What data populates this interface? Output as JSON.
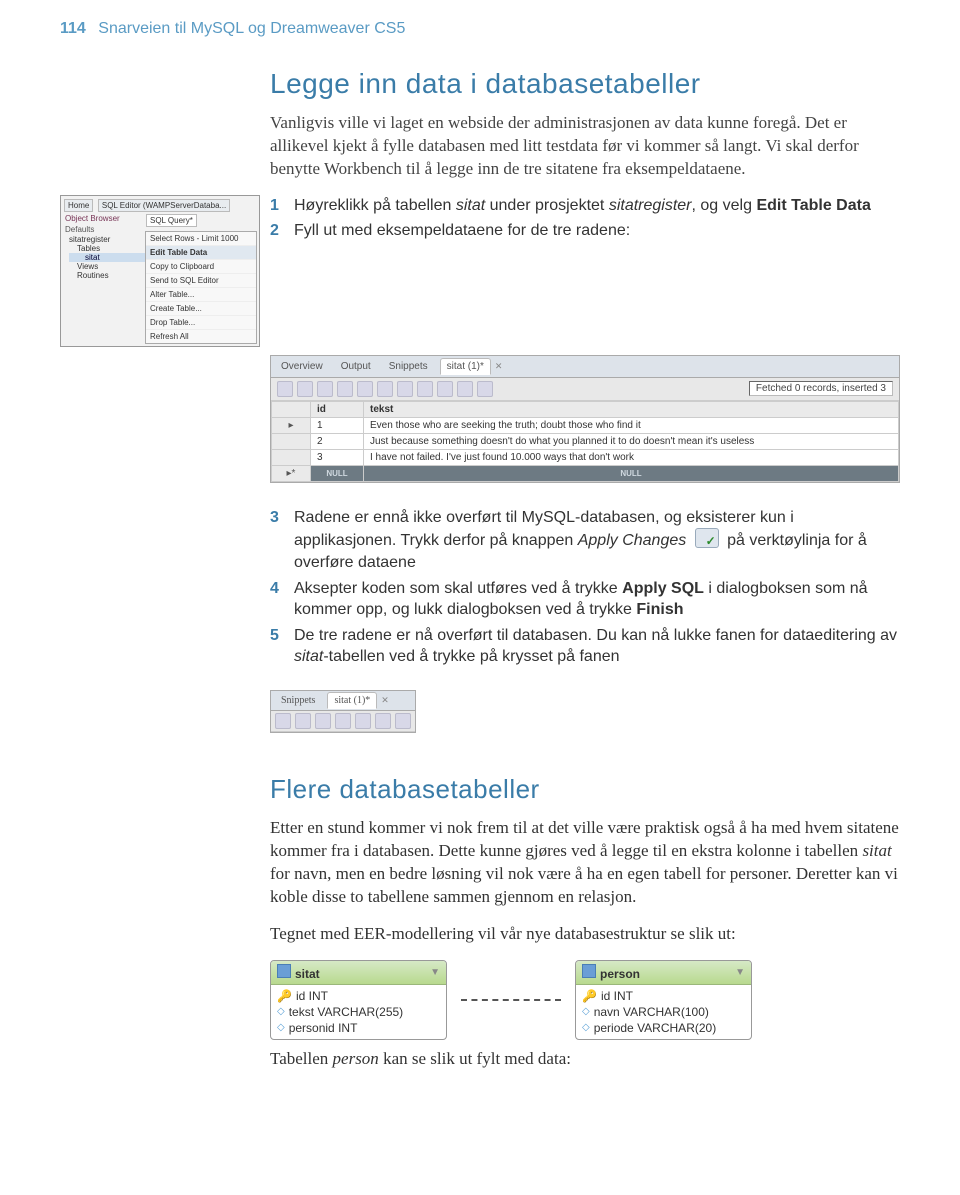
{
  "header": {
    "page_number": "114",
    "running_title": "Snarveien til MySQL og Dreamweaver CS5"
  },
  "section1": {
    "title": "Legge inn data i databasetabeller",
    "intro": "Vanligvis ville vi laget en webside der administrasjonen av data kunne foregå. Det er allikevel kjekt å fylle databasen med litt testdata før vi kommer så langt. Vi skal derfor benytte Workbench til å legge inn de tre sitatene fra eksempeldataene.",
    "workbench_left": {
      "home_tab": "Home",
      "server_tab": "SQL Editor (WAMPServerDataba...",
      "object_browser": "Object Browser",
      "sql_query_tab": "SQL Query*",
      "defaults": "Defaults",
      "tree": [
        "sitatregister",
        "Tables",
        "sitat",
        "Views",
        "Routines"
      ],
      "context_menu": [
        "Select Rows - Limit 1000",
        "Edit Table Data",
        "Copy to Clipboard",
        "Send to SQL Editor",
        "Alter Table...",
        "Create Table...",
        "Drop Table...",
        "Refresh All"
      ]
    },
    "step1": {
      "n": "1",
      "pre": "Høyreklikk på tabellen ",
      "em1": "sitat",
      "mid": " under prosjektet ",
      "em2": "sitatregister",
      "post": ", og velg ",
      "bold": "Edit Table Data"
    },
    "step2": {
      "n": "2",
      "text": "Fyll ut med eksempeldataene for de tre radene:"
    },
    "grid": {
      "tabs": [
        "Overview",
        "Output",
        "Snippets"
      ],
      "active_tab": "sitat (1)*",
      "fetched": "Fetched 0 records, inserted 3",
      "col_id": "id",
      "col_tekst": "tekst",
      "rows": [
        {
          "id": "1",
          "tekst": "Even those who are seeking the truth; doubt those who find it"
        },
        {
          "id": "2",
          "tekst": "Just because something doesn't do what you planned it to do doesn't mean it's useless"
        },
        {
          "id": "3",
          "tekst": "I have not failed. I've just found 10.000 ways that don't work"
        }
      ],
      "null_label": "NULL"
    },
    "step3": {
      "n": "3",
      "pre": "Radene er ennå ikke overført til MySQL-databasen, og eksisterer kun i applikasjonen. Trykk derfor på knappen ",
      "em": "Apply Changes",
      "post": " på verktøylinja for å overføre dataene"
    },
    "step4": {
      "n": "4",
      "pre": "Aksepter koden som skal utføres ved å trykke ",
      "b1": "Apply SQL",
      "mid": " i dialogboksen som nå kommer opp, og lukk dialogboksen ved å trykke ",
      "b2": "Finish"
    },
    "step5": {
      "n": "5",
      "pre": "De tre radene er nå overført til databasen. Du kan nå lukke fanen for dataeditering av ",
      "em": "sitat",
      "post": "-tabellen ved å trykke på krysset på fanen"
    },
    "small_tabs": {
      "tab1": "Snippets",
      "active_tab": "sitat (1)*"
    }
  },
  "section2": {
    "title": "Flere databasetabeller",
    "p1a": "Etter en stund kommer vi nok frem til at det ville være praktisk også å ha med hvem sitatene kommer fra i databasen. Dette kunne gjøres ved å legge til en ekstra kolonne i tabellen ",
    "p1em": "sitat",
    "p1b": " for navn, men en bedre løsning vil nok være å ha en egen tabell for personer. Deretter kan vi koble disse to tabellene sammen gjennom en relasjon.",
    "p2": "Tegnet med EER-modellering vil vår nye databasestruktur se slik ut:",
    "eer": {
      "table1": {
        "name": "sitat",
        "cols": [
          "id INT",
          "tekst VARCHAR(255)",
          "personid INT"
        ]
      },
      "table2": {
        "name": "person",
        "cols": [
          "id INT",
          "navn VARCHAR(100)",
          "periode VARCHAR(20)"
        ]
      }
    },
    "p3a": "Tabellen ",
    "p3em": "person",
    "p3b": " kan se slik ut fylt med data:"
  }
}
